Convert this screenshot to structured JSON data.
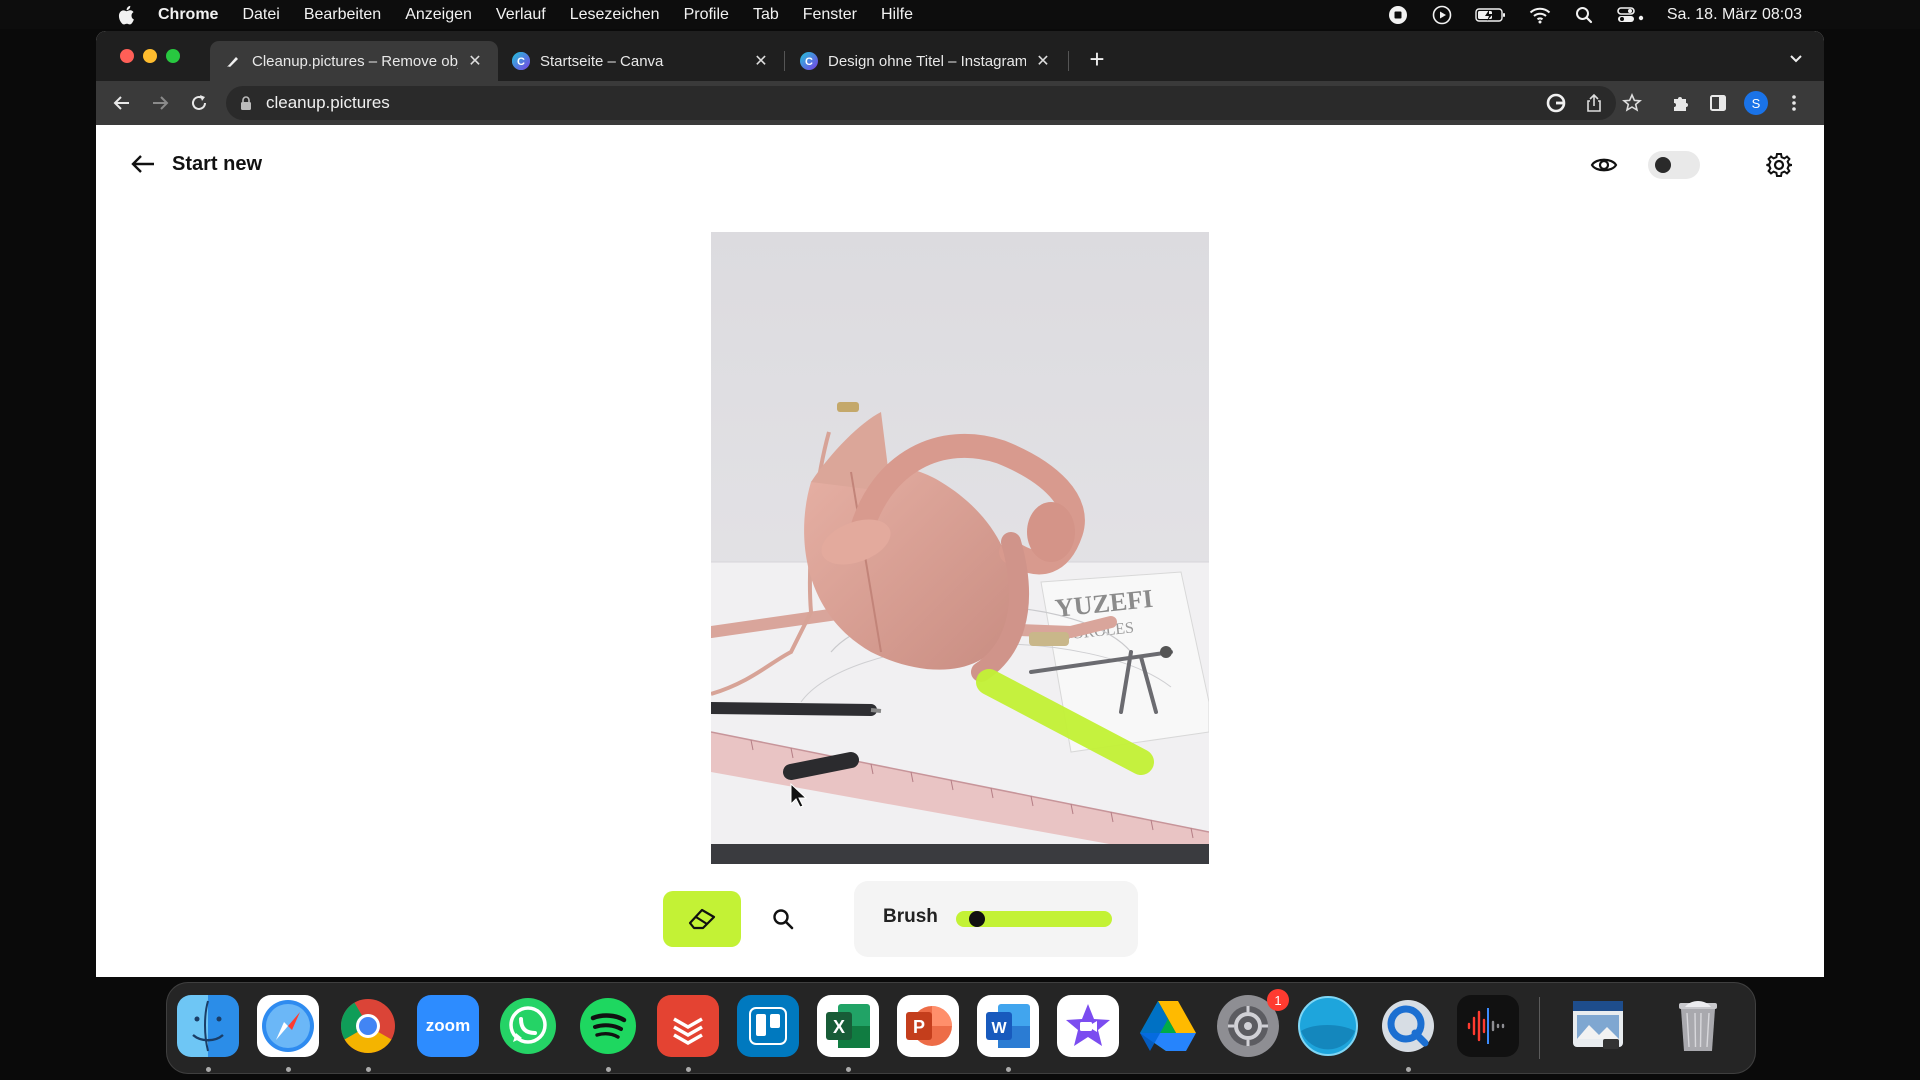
{
  "menubar": {
    "app_name": "Chrome",
    "items": [
      "Datei",
      "Bearbeiten",
      "Anzeigen",
      "Verlauf",
      "Lesezeichen",
      "Profile",
      "Tab",
      "Fenster",
      "Hilfe"
    ],
    "clock": "Sa. 18. März  08:03",
    "status_icons": [
      "record-icon",
      "play-icon",
      "battery-icon",
      "wifi-icon",
      "spotlight-search-icon",
      "control-center-icon"
    ]
  },
  "browser": {
    "tabs": [
      {
        "label": "Cleanup.pictures – Remove obj",
        "favicon": "cleanup-favicon",
        "active": true
      },
      {
        "label": "Startseite – Canva",
        "favicon": "canva-favicon",
        "active": false
      },
      {
        "label": "Design ohne Titel – Instagram-",
        "favicon": "canva-favicon",
        "active": false
      }
    ],
    "url": "cleanup.pictures",
    "profile_initial": "S"
  },
  "app": {
    "start_new_label": "Start new",
    "brush_label": "Brush",
    "brush_size": 0.05,
    "accent_color": "#c3f235",
    "dark_mode_toggle": false
  },
  "dock": {
    "apps": [
      "Finder",
      "Safari",
      "Google Chrome",
      "Zoom",
      "WhatsApp",
      "Spotify",
      "Todoist",
      "Trello",
      "Microsoft Excel",
      "Microsoft PowerPoint",
      "Microsoft Word",
      "iMovie",
      "Google Drive",
      "System Settings",
      "Mercury",
      "QuickTime Player",
      "Voice Memos",
      "Preview",
      "Trash"
    ],
    "zoom_label": "zoom",
    "settings_badge": "1",
    "excel_letter": "X",
    "word_letter": "W"
  }
}
